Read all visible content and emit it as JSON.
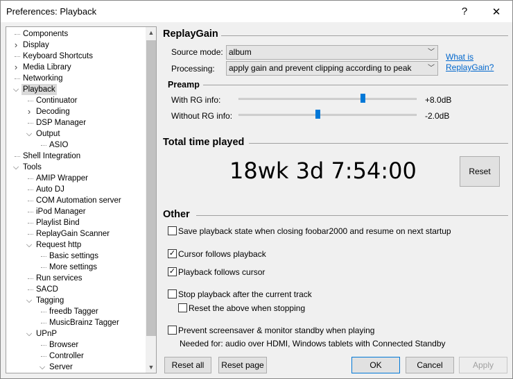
{
  "window": {
    "title": "Preferences: Playback",
    "help_glyph": "?",
    "close_glyph": "✕"
  },
  "tree": [
    {
      "label": "Components",
      "level": 0,
      "expander": ""
    },
    {
      "label": "Display",
      "level": 0,
      "expander": "collapsed"
    },
    {
      "label": "Keyboard Shortcuts",
      "level": 0,
      "expander": ""
    },
    {
      "label": "Media Library",
      "level": 0,
      "expander": "collapsed"
    },
    {
      "label": "Networking",
      "level": 0,
      "expander": ""
    },
    {
      "label": "Playback",
      "level": 0,
      "expander": "expanded",
      "selected": true
    },
    {
      "label": "Continuator",
      "level": 1,
      "expander": ""
    },
    {
      "label": "Decoding",
      "level": 1,
      "expander": "collapsed"
    },
    {
      "label": "DSP Manager",
      "level": 1,
      "expander": ""
    },
    {
      "label": "Output",
      "level": 1,
      "expander": "expanded"
    },
    {
      "label": "ASIO",
      "level": 2,
      "expander": ""
    },
    {
      "label": "Shell Integration",
      "level": 0,
      "expander": ""
    },
    {
      "label": "Tools",
      "level": 0,
      "expander": "expanded"
    },
    {
      "label": "AMIP Wrapper",
      "level": 1,
      "expander": ""
    },
    {
      "label": "Auto DJ",
      "level": 1,
      "expander": ""
    },
    {
      "label": "COM Automation server",
      "level": 1,
      "expander": ""
    },
    {
      "label": "iPod Manager",
      "level": 1,
      "expander": ""
    },
    {
      "label": "Playlist Bind",
      "level": 1,
      "expander": ""
    },
    {
      "label": "ReplayGain Scanner",
      "level": 1,
      "expander": ""
    },
    {
      "label": "Request http",
      "level": 1,
      "expander": "expanded"
    },
    {
      "label": "Basic settings",
      "level": 2,
      "expander": ""
    },
    {
      "label": "More settings",
      "level": 2,
      "expander": ""
    },
    {
      "label": "Run services",
      "level": 1,
      "expander": ""
    },
    {
      "label": "SACD",
      "level": 1,
      "expander": ""
    },
    {
      "label": "Tagging",
      "level": 1,
      "expander": "expanded"
    },
    {
      "label": "freedb Tagger",
      "level": 2,
      "expander": ""
    },
    {
      "label": "MusicBrainz Tagger",
      "level": 2,
      "expander": ""
    },
    {
      "label": "UPnP",
      "level": 1,
      "expander": "expanded"
    },
    {
      "label": "Browser",
      "level": 2,
      "expander": ""
    },
    {
      "label": "Controller",
      "level": 2,
      "expander": ""
    },
    {
      "label": "Server",
      "level": 2,
      "expander": "expanded"
    }
  ],
  "replaygain": {
    "heading": "ReplayGain",
    "source_mode_label": "Source mode:",
    "source_mode_value": "album",
    "processing_label": "Processing:",
    "processing_value": "apply gain and prevent clipping according to peak",
    "link_line1": "What is",
    "link_line2": "ReplayGain?"
  },
  "preamp": {
    "heading": "Preamp",
    "with_label": "With RG info:",
    "with_value": "+8.0dB",
    "with_position": 0.695,
    "without_label": "Without RG info:",
    "without_value": "-2.0dB",
    "without_position": 0.445
  },
  "total_time": {
    "heading": "Total time played",
    "value": "18wk 3d 7:54:00",
    "reset_label": "Reset"
  },
  "other": {
    "heading": "Other",
    "save_state": {
      "label": "Save playback state when closing foobar2000 and resume on next startup",
      "checked": false
    },
    "cursor_follows": {
      "label": "Cursor follows playback",
      "checked": true
    },
    "playback_follows": {
      "label": "Playback follows cursor",
      "checked": true
    },
    "stop_after": {
      "label": "Stop playback after the current track",
      "checked": false
    },
    "reset_above": {
      "label": "Reset the above when stopping",
      "checked": false
    },
    "prevent_screensaver": {
      "label": "Prevent screensaver & monitor standby when playing",
      "checked": false
    },
    "needed_for": "Needed for: audio over HDMI, Windows tablets with Connected Standby"
  },
  "buttons": {
    "reset_all": "Reset all",
    "reset_page": "Reset page",
    "ok": "OK",
    "cancel": "Cancel",
    "apply": "Apply"
  },
  "colors": {
    "accent": "#0078d7",
    "link": "#0066cc",
    "selection": "#d9d9d9"
  }
}
